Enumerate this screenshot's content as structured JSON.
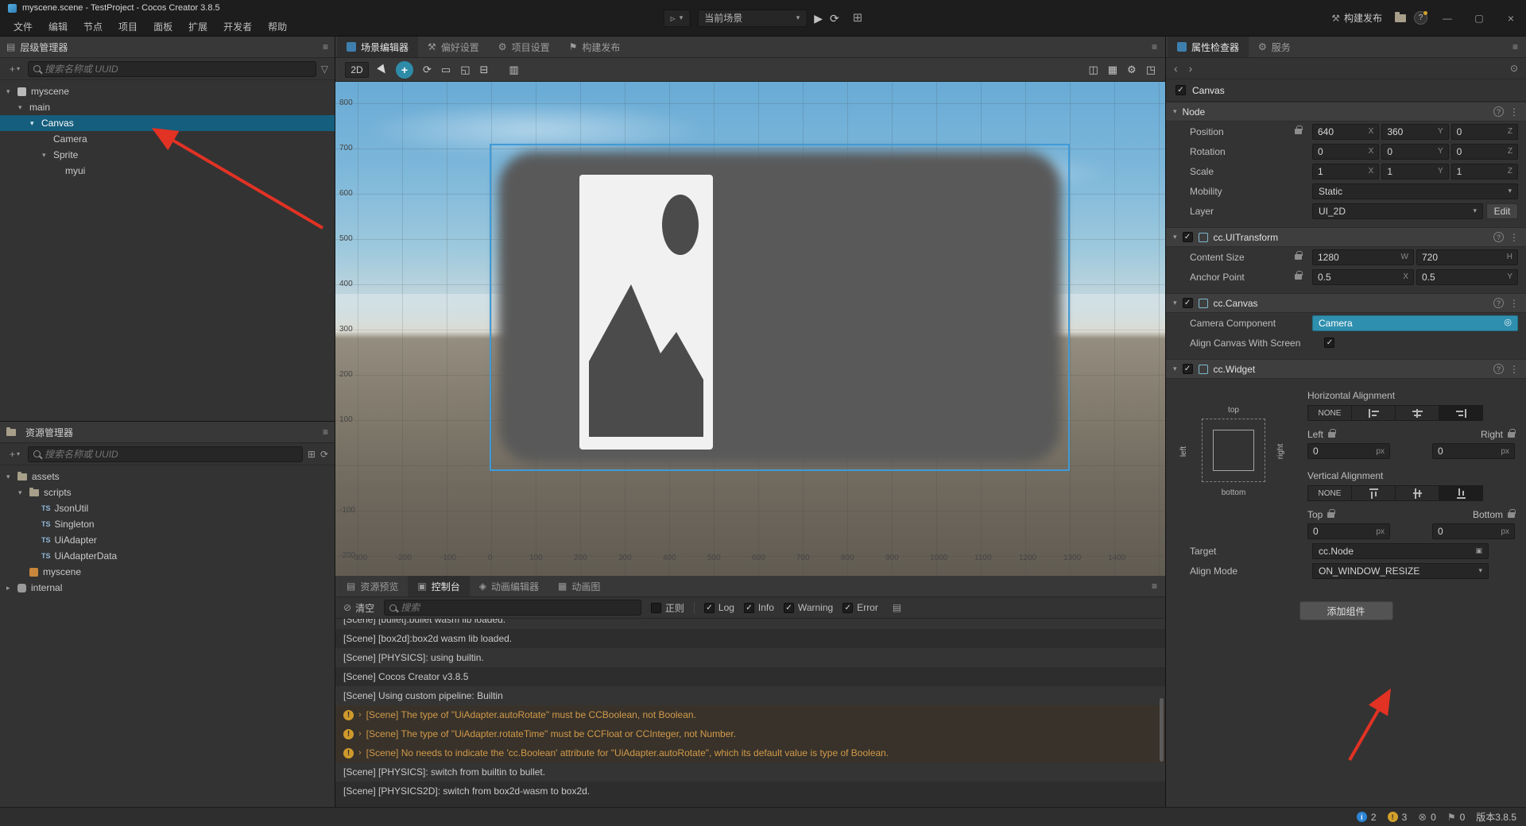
{
  "titlebar": {
    "title": "myscene.scene - TestProject - Cocos Creator 3.8.5",
    "menus": [
      "文件",
      "编辑",
      "节点",
      "项目",
      "面板",
      "扩展",
      "开发者",
      "帮助"
    ],
    "scene_selector": "当前场景",
    "build_button": "构建发布"
  },
  "hierarchy": {
    "title": "层级管理器",
    "search_placeholder": "搜索名称或 UUID",
    "nodes": [
      {
        "label": "myscene"
      },
      {
        "label": "main"
      },
      {
        "label": "Canvas"
      },
      {
        "label": "Camera"
      },
      {
        "label": "Sprite"
      },
      {
        "label": "myui"
      }
    ]
  },
  "assets": {
    "title": "资源管理器",
    "search_placeholder": "搜索名称或 UUID",
    "ts_badge": "TS",
    "nodes": [
      {
        "label": "assets"
      },
      {
        "label": "scripts"
      },
      {
        "label": "JsonUtil"
      },
      {
        "label": "Singleton"
      },
      {
        "label": "UiAdapter"
      },
      {
        "label": "UiAdapterData"
      },
      {
        "label": "myscene"
      },
      {
        "label": "internal"
      }
    ]
  },
  "scene": {
    "tabs": [
      {
        "label": "场景编辑器"
      },
      {
        "label": "偏好设置"
      },
      {
        "label": "项目设置"
      },
      {
        "label": "构建发布"
      }
    ],
    "mode_2d": "2D",
    "ruler_y": [
      "800",
      "700",
      "600",
      "500",
      "400",
      "300",
      "200",
      "100",
      "-100",
      "-200"
    ],
    "ruler_x": [
      "-300",
      "-200",
      "-100",
      "0",
      "100",
      "200",
      "300",
      "400",
      "500",
      "600",
      "700",
      "800",
      "900",
      "1000",
      "1100",
      "1200",
      "1300",
      "1400"
    ]
  },
  "console": {
    "tabs": [
      "资源预览",
      "控制台",
      "动画编辑器",
      "动画图"
    ],
    "clear_label": "清空",
    "search_placeholder": "搜索",
    "regex_label": "正则",
    "filters": [
      "Log",
      "Info",
      "Warning",
      "Error"
    ],
    "logs": [
      {
        "text": "[Scene] [bullet]:bullet wasm lib loaded.",
        "type": "log"
      },
      {
        "text": "[Scene] [box2d]:box2d wasm lib loaded.",
        "type": "log"
      },
      {
        "text": "[Scene] [PHYSICS]: using builtin.",
        "type": "log"
      },
      {
        "text": "[Scene] Cocos Creator v3.8.5",
        "type": "log"
      },
      {
        "text": "[Scene] Using custom pipeline: Builtin",
        "type": "log"
      },
      {
        "text": "[Scene] The type of \"UiAdapter.autoRotate\" must be CCBoolean, not Boolean.",
        "type": "warning"
      },
      {
        "text": "[Scene] The type of \"UiAdapter.rotateTime\" must be CCFloat or CCInteger, not Number.",
        "type": "warning"
      },
      {
        "text": "[Scene] No needs to indicate the 'cc.Boolean' attribute for \"UiAdapter.autoRotate\", which its default value is type of Boolean.",
        "type": "warning"
      },
      {
        "text": "[Scene] [PHYSICS]: switch from builtin to bullet.",
        "type": "log"
      },
      {
        "text": "[Scene] [PHYSICS2D]: switch from box2d-wasm to box2d.",
        "type": "log"
      }
    ]
  },
  "inspector": {
    "tabs": [
      {
        "label": "属性检查器"
      },
      {
        "label": "服务"
      }
    ],
    "node_name": "Canvas",
    "axes": {
      "x": "X",
      "y": "Y",
      "z": "Z",
      "w": "W",
      "h": "H"
    },
    "node": {
      "title": "Node",
      "position_label": "Position",
      "position": [
        "640",
        "360",
        "0"
      ],
      "rotation_label": "Rotation",
      "rotation": [
        "0",
        "0",
        "0"
      ],
      "scale_label": "Scale",
      "scale": [
        "1",
        "1",
        "1"
      ],
      "mobility_label": "Mobility",
      "mobility_value": "Static",
      "layer_label": "Layer",
      "layer_value": "UI_2D",
      "layer_edit": "Edit"
    },
    "uitransform": {
      "title": "cc.UITransform",
      "content_size_label": "Content Size",
      "content_size": [
        "1280",
        "720"
      ],
      "anchor_label": "Anchor Point",
      "anchor": [
        "0.5",
        "0.5"
      ]
    },
    "canvas": {
      "title": "cc.Canvas",
      "camera_label": "Camera Component",
      "camera_value": "Camera",
      "align_label": "Align Canvas With Screen"
    },
    "widget": {
      "title": "cc.Widget",
      "horizontal_label": "Horizontal Alignment",
      "vertical_label": "Vertical Alignment",
      "none": "NONE",
      "left": "Left",
      "right": "Right",
      "top": "Top",
      "bottom": "Bottom",
      "left_value": "0",
      "right_value": "0",
      "top_value": "0",
      "bottom_value": "0",
      "px": "px",
      "target_label": "Target",
      "target_value": "cc.Node",
      "align_mode_label": "Align Mode",
      "align_mode_value": "ON_WINDOW_RESIZE",
      "diagram": {
        "top": "top",
        "bottom": "bottom",
        "left": "left",
        "right": "right"
      }
    },
    "add_component": "添加组件"
  },
  "statusbar": {
    "info_count": "2",
    "warning_count": "3",
    "error_count": "0",
    "notify_count": "0",
    "version": "版本3.8.5"
  }
}
